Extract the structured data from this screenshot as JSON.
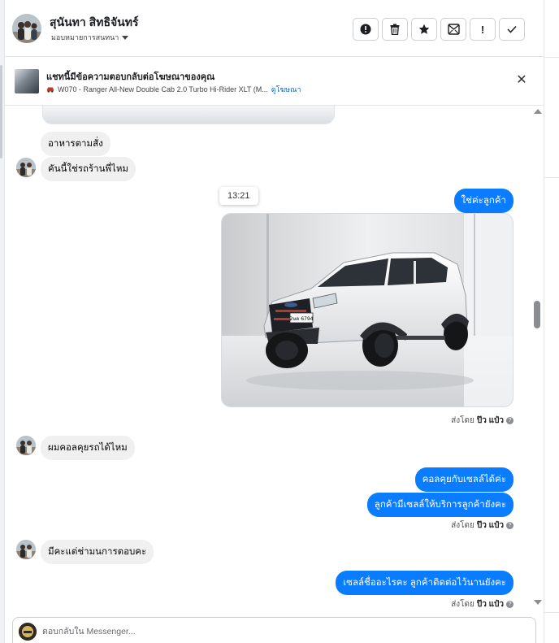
{
  "header": {
    "contact_name": "สุนันทา สิทธิจันทร์",
    "assign_label": "มอบหมายการสนทนา",
    "actions": [
      {
        "icon": "alert-circle-icon",
        "glyph": "!"
      },
      {
        "icon": "trash-icon",
        "glyph": ""
      },
      {
        "icon": "star-icon",
        "glyph": "★"
      },
      {
        "icon": "mark-unread-icon",
        "glyph": ""
      },
      {
        "icon": "exclamation-icon",
        "glyph": "!"
      },
      {
        "icon": "check-icon",
        "glyph": "✓"
      }
    ]
  },
  "banner": {
    "title": "แชทนี้มีข้อความตอบกลับต่อโฆษณาของคุณ",
    "ad_text": "W070 - Ranger All-New Double Cab 2.0 Turbo Hi-Rider XLT (M...",
    "link": "ดูโฆษณา"
  },
  "messages": {
    "m1": "อาหารตามสั่ง",
    "m2": "คันนี้ใช่รถร้านพี่ไหม",
    "time": "13:21",
    "m3": "ใช่ค่ะลูกค้า",
    "m4": "ผมคอลคุยรถได้ไหม",
    "m5": "คอลคุยกับเซลล์ได้ค่ะ",
    "m6": "ลูกค้ามีเซลล์ให้บริการลูกค้ายังคะ",
    "m7": "มีคะแต่ช่ามนการตอบคะ",
    "m8": "เซลล์ชื่ออะไรคะ  ลูกค้าติดต่อไว้นานยังคะ"
  },
  "sent_by": {
    "prefix": "ส่งโดย",
    "name": "ป๊ว แป๋ว"
  },
  "composer": {
    "placeholder": "ตอบกลับใน Messenger..."
  },
  "plate_text": "2ษค 6794"
}
